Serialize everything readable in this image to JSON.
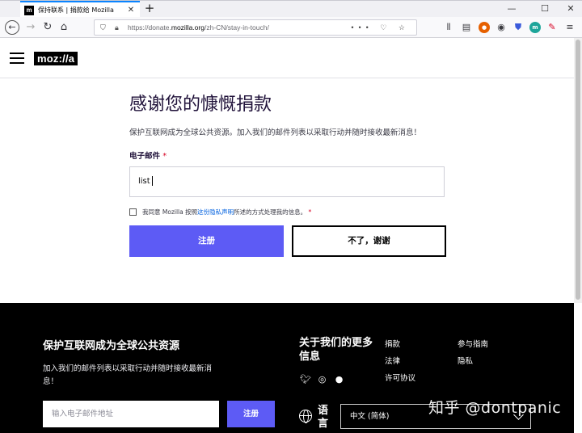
{
  "browser": {
    "tab_title": "保持联系 | 捐款给 Mozilla",
    "tab_favicon_letter": "m",
    "new_tab_symbol": "+",
    "url_prefix": "https://donate.",
    "url_domain": "mozilla.org",
    "url_suffix": "/zh-CN/stay-in-touch/",
    "url_actions": "•••"
  },
  "header": {
    "logo_text": "moz://a"
  },
  "form": {
    "title": "感谢您的慷慨捐款",
    "description": "保护互联网成为全球公共资源。加入我们的邮件列表以采取行动并随时接收最新消息！",
    "email_label": "电子邮件",
    "required_mark": "*",
    "email_value": "list",
    "consent_prefix": "我同意 Mozilla 按照",
    "consent_link": "这份隐私声明",
    "consent_suffix": "所述的方式处理我的信息。",
    "signup_button": "注册",
    "no_thanks_button": "不了，谢谢"
  },
  "footer": {
    "title": "保护互联网成为全球公共资源",
    "description": "加入我们的邮件列表以采取行动并随时接收最新消息！",
    "email_placeholder": "输入电子邮件地址",
    "signup_button": "注册",
    "about_title": "关于我们的更多信息",
    "links": {
      "donate": "捐款",
      "participation": "参与指南",
      "legal": "法律",
      "privacy": "隐私",
      "license": "许可协议"
    },
    "language_label": "语言",
    "language_value": "中文 (简体)"
  },
  "watermark": "知乎 @dontpanic",
  "colors": {
    "primary_button": "#5d5bf5",
    "footer_bg": "#000000",
    "link": "#0060df",
    "tab_accent": "#0a84ff"
  }
}
